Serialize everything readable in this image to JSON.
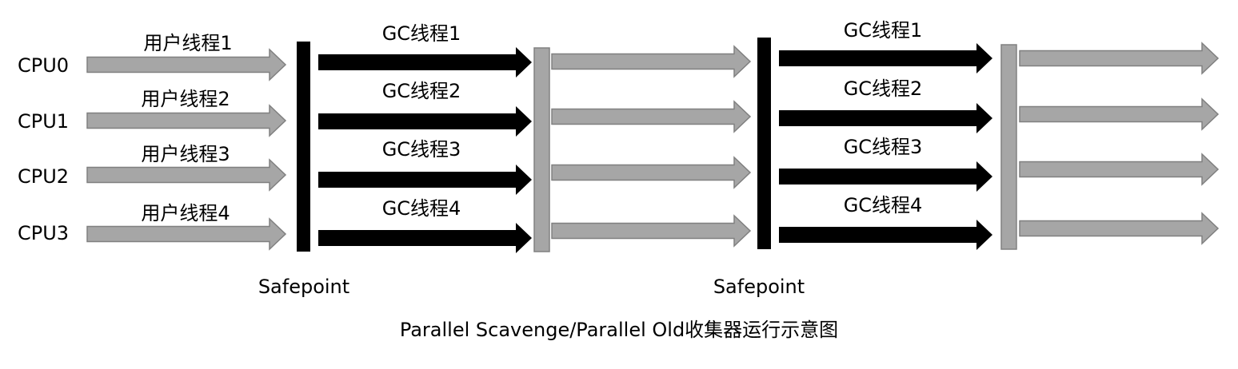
{
  "cpus": [
    "CPU0",
    "CPU1",
    "CPU2",
    "CPU3"
  ],
  "user_threads": [
    "用户线程1",
    "用户线程2",
    "用户线程3",
    "用户线程4"
  ],
  "gc_threads_1": [
    "GC线程1",
    "GC线程2",
    "GC线程3",
    "GC线程4"
  ],
  "gc_threads_2": [
    "GC线程1",
    "GC线程2",
    "GC线程3",
    "GC线程4"
  ],
  "safepoint_labels": [
    "Safepoint",
    "Safepoint"
  ],
  "caption": "Parallel Scavenge/Parallel Old收集器运行示意图",
  "colors": {
    "user_arrow": "#a6a6a6",
    "gc_arrow": "#000000",
    "safepoint_bar": "#000000",
    "resume_bar": "#a6a6a6"
  }
}
